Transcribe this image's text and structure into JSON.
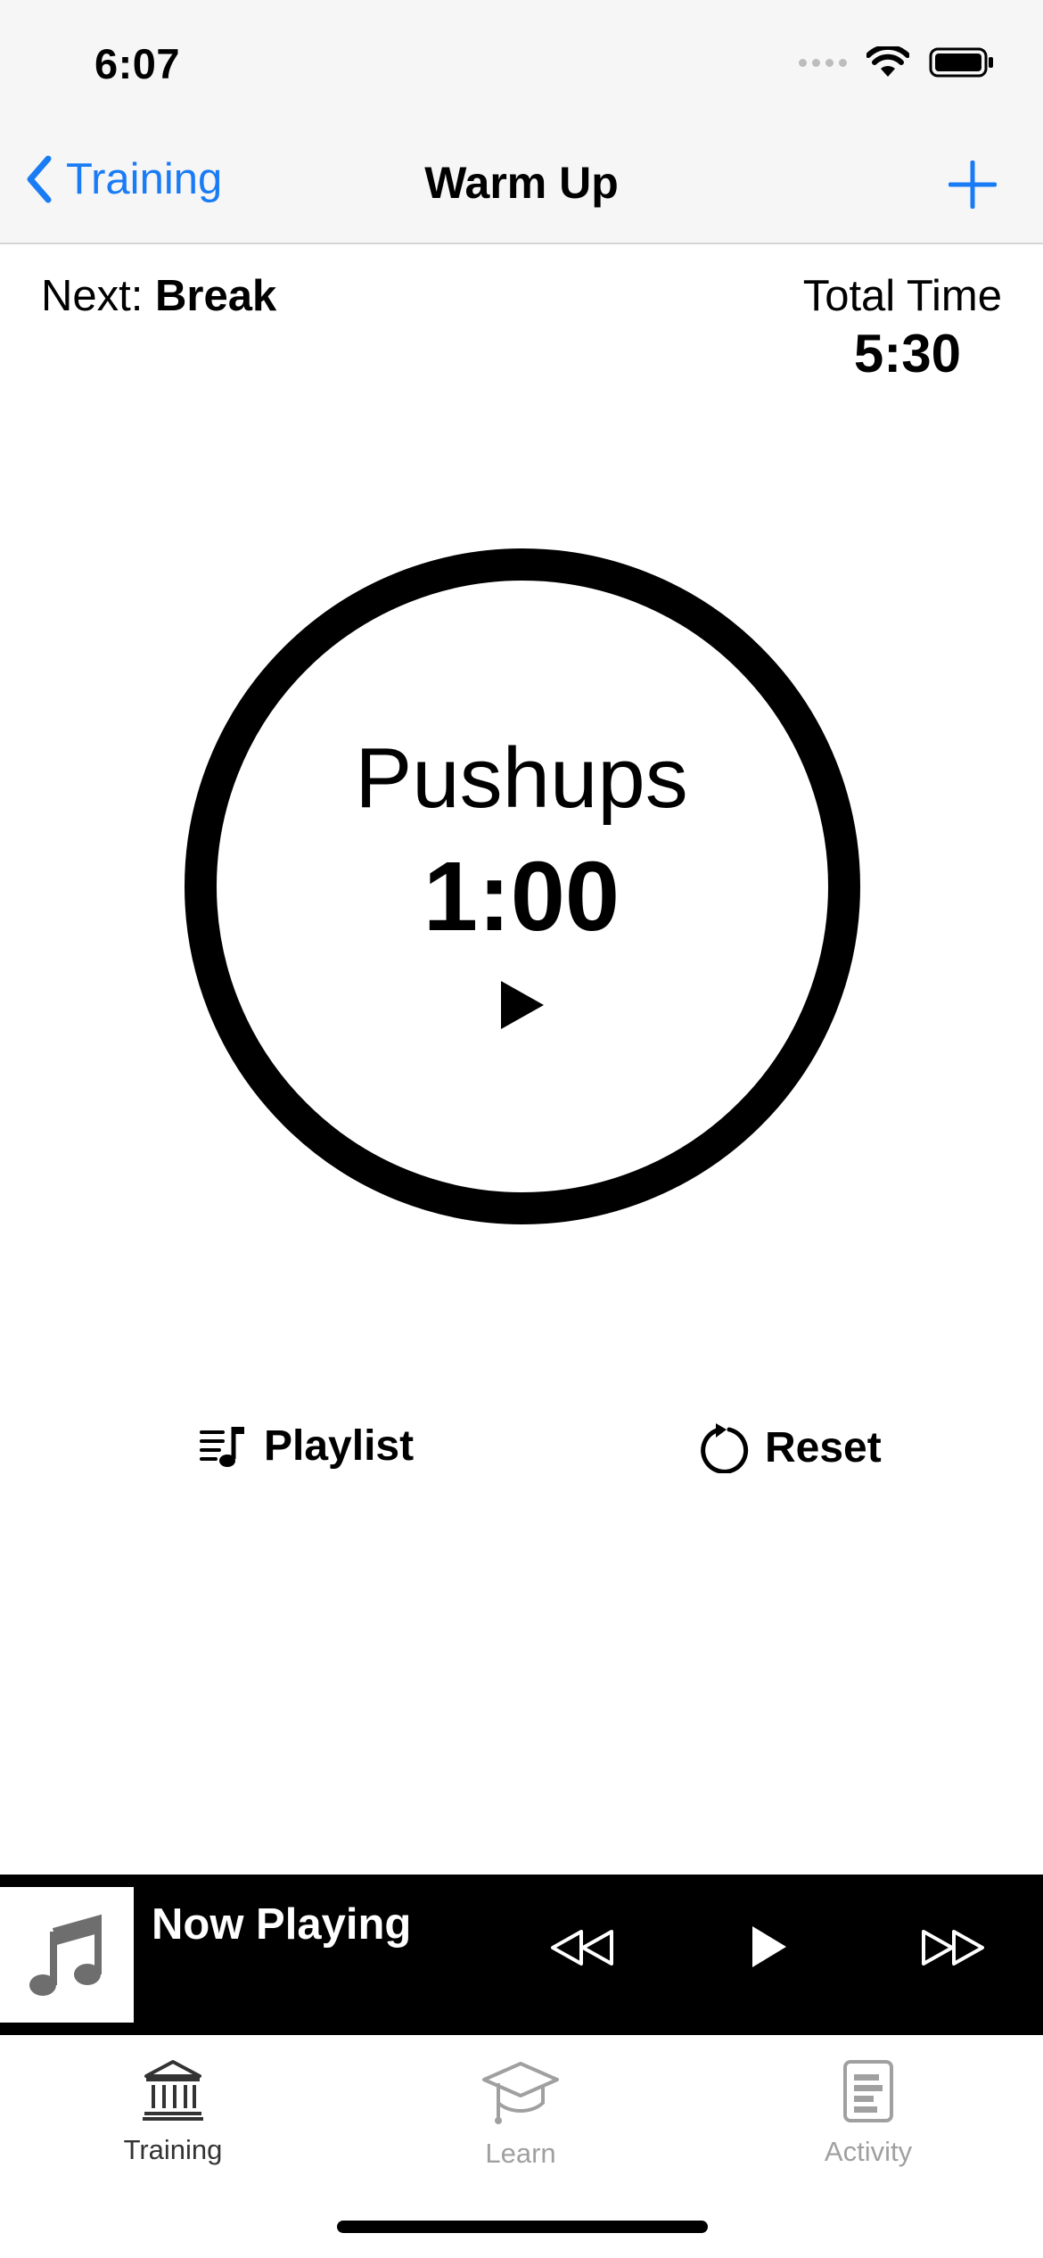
{
  "status_bar": {
    "time": "6:07"
  },
  "nav": {
    "back_label": "Training",
    "title": "Warm Up"
  },
  "info": {
    "next_prefix": "Next: ",
    "next_value": "Break",
    "total_label": "Total Time",
    "total_value": "5:30"
  },
  "timer": {
    "exercise": "Pushups",
    "time": "1:00"
  },
  "actions": {
    "playlist_label": "Playlist",
    "reset_label": "Reset"
  },
  "now_playing": {
    "title": "Now Playing"
  },
  "tabs": [
    {
      "label": "Training",
      "icon": "bank-icon",
      "active": true
    },
    {
      "label": "Learn",
      "icon": "graduation-cap-icon",
      "active": false
    },
    {
      "label": "Activity",
      "icon": "document-icon",
      "active": false
    }
  ],
  "colors": {
    "accent": "#1a7cf5",
    "inactive": "#a0a0a0",
    "bar": "#000000"
  }
}
